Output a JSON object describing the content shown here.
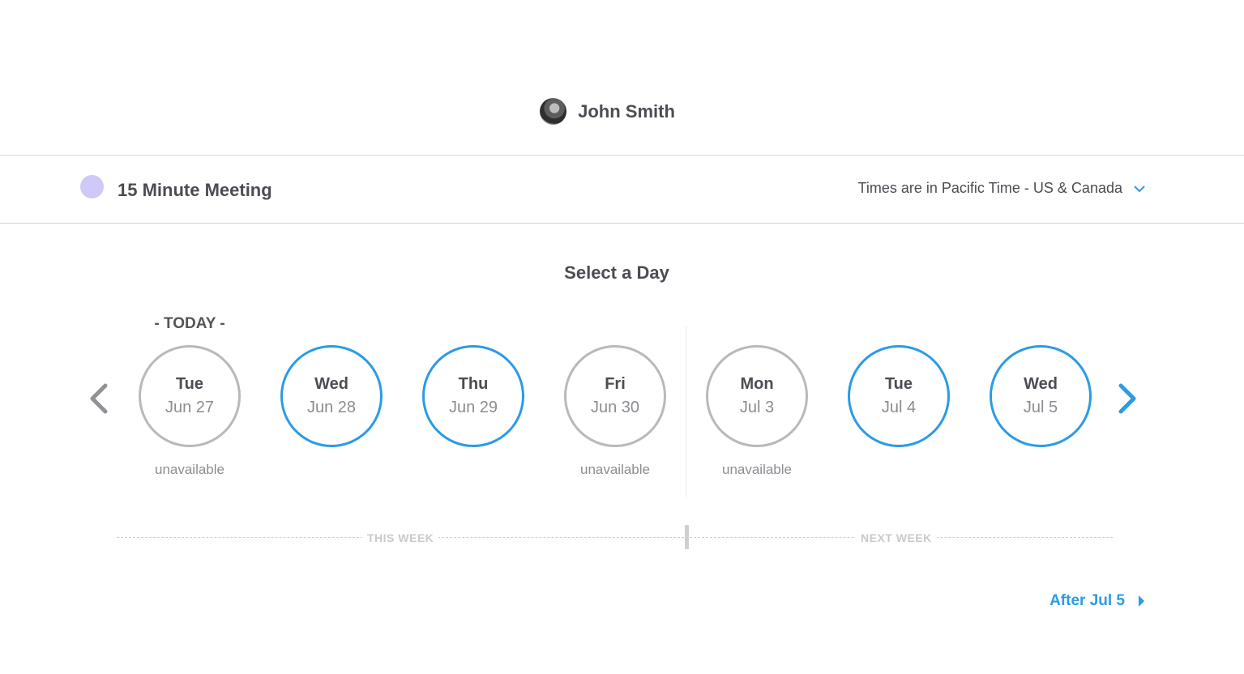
{
  "header": {
    "user_name": "John Smith"
  },
  "event": {
    "name": "15 Minute Meeting",
    "dot_color": "#cfc9f7",
    "timezone_label": "Times are in Pacific Time - US & Canada"
  },
  "picker": {
    "title": "Select a Day",
    "today_label": "- TODAY -",
    "days": [
      {
        "weekday": "Tue",
        "date": "Jun 27",
        "available": false,
        "status": "unavailable"
      },
      {
        "weekday": "Wed",
        "date": "Jun 28",
        "available": true,
        "status": ""
      },
      {
        "weekday": "Thu",
        "date": "Jun 29",
        "available": true,
        "status": ""
      },
      {
        "weekday": "Fri",
        "date": "Jun 30",
        "available": false,
        "status": "unavailable"
      },
      {
        "weekday": "Mon",
        "date": "Jul 3",
        "available": false,
        "status": "unavailable"
      },
      {
        "weekday": "Tue",
        "date": "Jul 4",
        "available": true,
        "status": ""
      },
      {
        "weekday": "Wed",
        "date": "Jul 5",
        "available": true,
        "status": ""
      }
    ],
    "this_week_label": "THIS WEEK",
    "next_week_label": "NEXT WEEK",
    "after_label": "After Jul 5"
  },
  "colors": {
    "accent": "#2b9be5",
    "unavailable_border": "#b9b9b9"
  }
}
